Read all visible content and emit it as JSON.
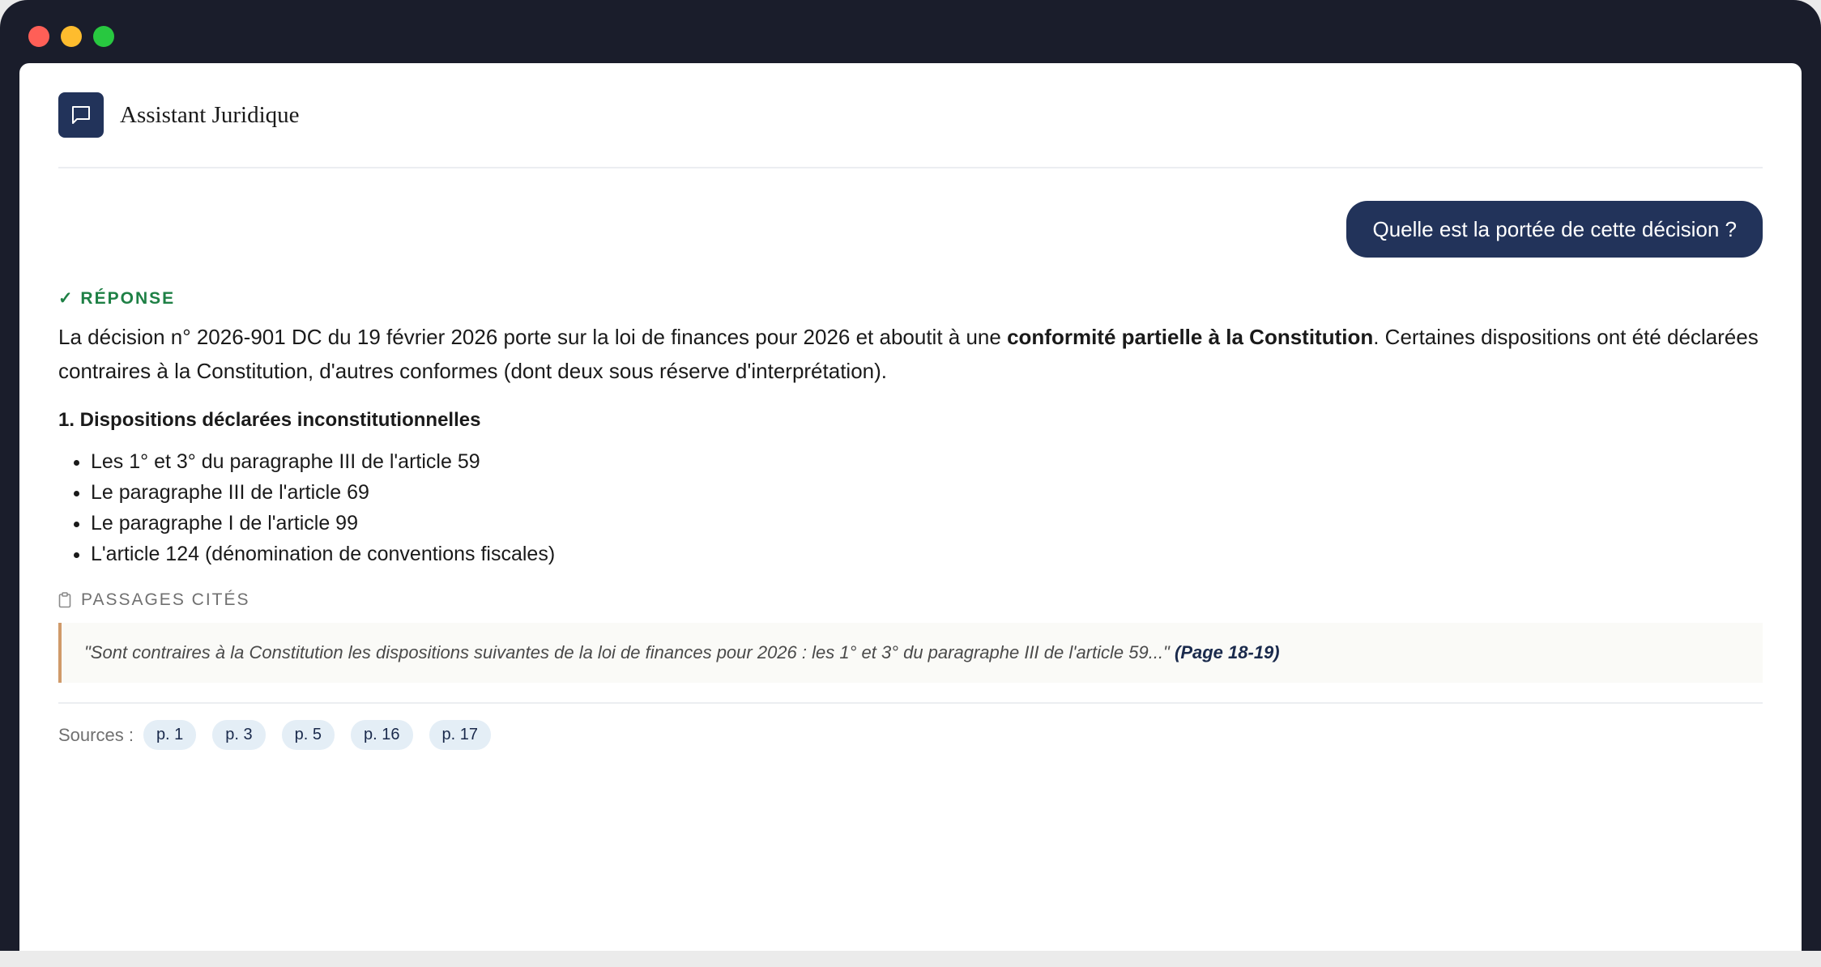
{
  "app": {
    "title": "Assistant Juridique",
    "icon": "message-square-icon"
  },
  "conversation": {
    "user_message": "Quelle est la portée de cette décision ?",
    "response": {
      "label": "✓ RÉPONSE",
      "intro_pre": "La décision n° 2026-901 DC du 19 février 2026 porte sur la loi de finances pour 2026 et aboutit à une ",
      "intro_bold": "conformité partielle à la Constitution",
      "intro_post": ". Certaines dispositions ont été déclarées contraires à la Constitution, d'autres conformes (dont deux sous réserve d'interprétation).",
      "section_heading": "1. Dispositions déclarées inconstitutionnelles",
      "items": [
        "Les 1° et 3° du paragraphe III de l'article 59",
        "Le paragraphe III de l'article 69",
        "Le paragraphe I de l'article 99",
        "L'article 124 (dénomination de conventions fiscales)"
      ]
    },
    "cited": {
      "label": "PASSAGES CITÉS",
      "icon": "clipboard-icon",
      "quote_text": "\"Sont contraires à la Constitution les dispositions suivantes de la loi de finances pour 2026 : les 1° et 3° du paragraphe III de l'article 59...\"",
      "page_ref": "(Page 18-19)"
    },
    "sources": {
      "label": "Sources :",
      "chips": [
        "p. 1",
        "p. 3",
        "p. 5",
        "p. 16",
        "p. 17"
      ]
    }
  },
  "colors": {
    "window_frame": "#1a1d2b",
    "brand_navy": "#22335a",
    "success_green": "#1e8045",
    "quote_accent": "#d09a6a",
    "chip_bg": "#e4eef6"
  }
}
